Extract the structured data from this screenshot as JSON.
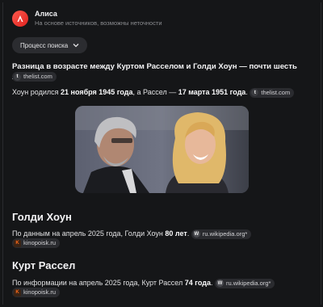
{
  "header": {
    "app_name": "Алиса",
    "subtitle": "На основе источников, возможны неточности",
    "logo_icon": "alice-logo-icon"
  },
  "process_button": {
    "label": "Процесс поиска",
    "icon": "chevron-down-icon"
  },
  "answer": {
    "headline": "Разница в возрасте между Куртом Расселом и Голди Хоун — почти шесть лет.",
    "headline_source": {
      "icon_letter": "t",
      "label": "thelist.com"
    },
    "line2": {
      "part1": "Хоун родился ",
      "date1": "21 ноября 1945 года",
      "part2": ", а Рассел — ",
      "date2": "17 марта 1951 года",
      "part3": ".",
      "source": {
        "icon_letter": "t",
        "label": "thelist.com"
      }
    },
    "photo_alt": "photo"
  },
  "sections": [
    {
      "title": "Голди Хоун",
      "text_before": "По данным на апрель 2025 года, Голди Хоун ",
      "bold": "80 лет",
      "text_after": ".",
      "source1": {
        "icon_letter": "W",
        "label": "ru.wikipedia.org*"
      },
      "source2": {
        "icon_letter": "K",
        "label": "kinopoisk.ru"
      }
    },
    {
      "title": "Курт Рассел",
      "text_before": "По информации на апрель 2025 года, Курт Рассел ",
      "bold": "74 года",
      "text_after": ".",
      "source1": {
        "icon_letter": "W",
        "label": "ru.wikipedia.org*"
      },
      "source2": {
        "icon_letter": "K",
        "label": "kinopoisk.ru"
      }
    }
  ],
  "colors": {
    "background": "#151618",
    "accent": "#ff3b30",
    "chip_bg": "#2a2b2f"
  }
}
